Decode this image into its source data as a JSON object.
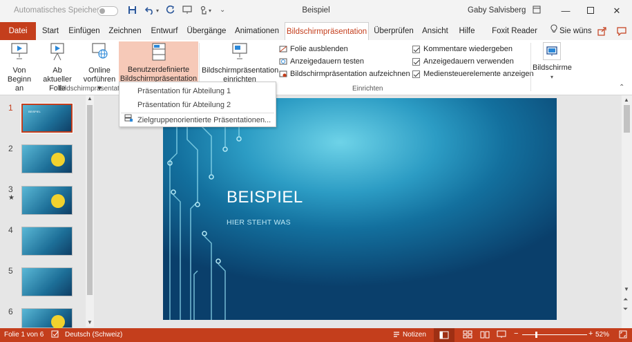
{
  "titlebar": {
    "autosave_label": "Automatisches Speichern",
    "doc_title": "Beispiel",
    "user_name": "Gaby Salvisberg"
  },
  "tabs": [
    {
      "label": "Datei"
    },
    {
      "label": "Start"
    },
    {
      "label": "Einfügen"
    },
    {
      "label": "Zeichnen"
    },
    {
      "label": "Entwurf"
    },
    {
      "label": "Übergänge"
    },
    {
      "label": "Animationen"
    },
    {
      "label": "Bildschirmpräsentation"
    },
    {
      "label": "Überprüfen"
    },
    {
      "label": "Ansicht"
    },
    {
      "label": "Hilfe"
    },
    {
      "label": "Foxit Reader PDF"
    },
    {
      "label": "Sie wüns"
    }
  ],
  "ribbon": {
    "start": {
      "from_beginning_1": "Von",
      "from_beginning_2": "Beginn an",
      "from_current_1": "Ab aktueller",
      "from_current_2": "Folie",
      "online_1": "Online",
      "online_2": "vorführen ▾",
      "custom_1": "Benutzerdefinierte",
      "custom_2": "Bildschirmpräsentation ▾",
      "group_label": "Bildschirmpräsentatio"
    },
    "setup": {
      "setup_1": "Bildschirmpräsentation",
      "setup_2": "einrichten",
      "hide_slide": "Folie ausblenden",
      "rehearse": "Anzeigedauern testen",
      "record": "Bildschirmpräsentation aufzeichnen",
      "record_arrow": "▾",
      "play_narrations": "Kommentare wiedergeben",
      "use_timings": "Anzeigedauern verwenden",
      "show_media_controls": "Mediensteuerelemente anzeigen",
      "group_label": "Einrichten"
    },
    "monitors": {
      "label": "Bildschirme",
      "arrow": "▾"
    }
  },
  "dropdown": {
    "items": [
      "Präsentation für Abteilung 1",
      "Präsentation für Abteilung 2"
    ],
    "custom_shows": "Zielgruppenorientierte Präsentationen..."
  },
  "thumbnails": [
    {
      "num": "1",
      "title": "BEISPIEL",
      "smiley": false
    },
    {
      "num": "2",
      "title": "",
      "smiley": true
    },
    {
      "num": "3",
      "title": "",
      "smiley": true,
      "star": "★"
    },
    {
      "num": "4",
      "title": "",
      "smiley": false
    },
    {
      "num": "5",
      "title": "",
      "smiley": false
    },
    {
      "num": "6",
      "title": "",
      "smiley": true
    }
  ],
  "slide": {
    "title": "BEISPIEL",
    "subtitle": "HIER STEHT WAS"
  },
  "status": {
    "slide_info": "Folie 1 von 6",
    "language": "Deutsch (Schweiz)",
    "notes": "Notizen",
    "zoom": "52%"
  },
  "colors": {
    "accent": "#c43e1c",
    "highlight": "#f6c9b8"
  }
}
